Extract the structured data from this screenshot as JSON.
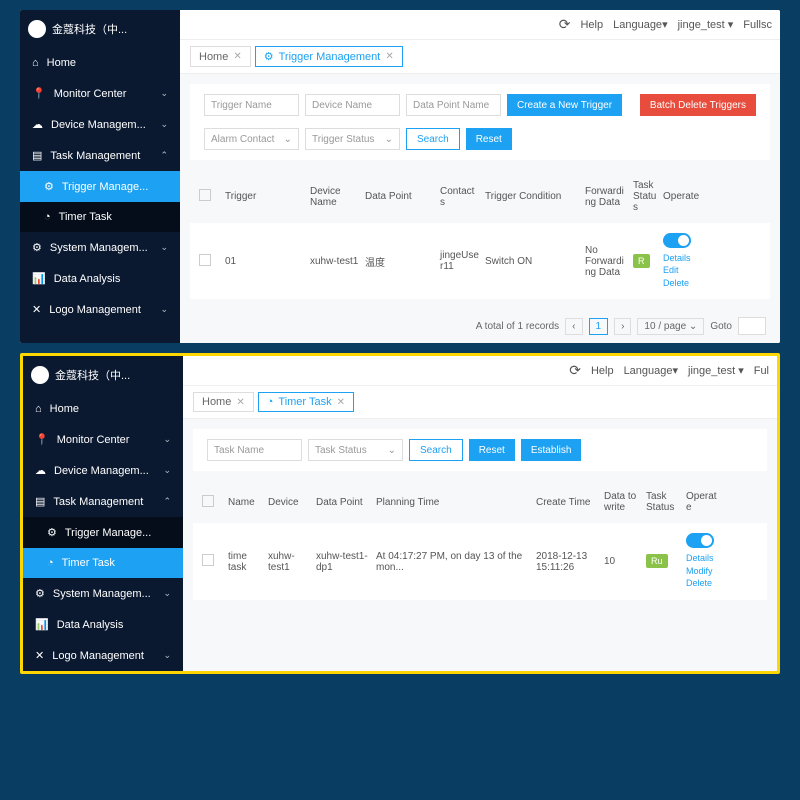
{
  "brand": "金蔻科技（中...",
  "topbar": {
    "help": "Help",
    "language": "Language",
    "user": "jinge_test",
    "full": "Fullsc"
  },
  "nav": {
    "home": "Home",
    "monitor": "Monitor Center",
    "device": "Device Managem...",
    "task": "Task Management",
    "trigger": "Trigger Manage...",
    "timer": "Timer Task",
    "system": "System Managem...",
    "data": "Data Analysis",
    "logo": "Logo Management"
  },
  "s1": {
    "tabs": {
      "home": "Home",
      "trigger": "Trigger Management"
    },
    "filters": {
      "trigger_name": "Trigger Name",
      "device_name": "Device Name",
      "dp_name": "Data Point Name",
      "alarm_contact": "Alarm Contact",
      "trigger_status": "Trigger Status",
      "search": "Search",
      "reset": "Reset",
      "create": "Create a New Trigger",
      "delete": "Batch Delete Triggers"
    },
    "headers": {
      "trigger": "Trigger",
      "device": "Device Name",
      "dp": "Data Point",
      "contacts": "Contacts",
      "cond": "Trigger Condition",
      "fwd": "Forwarding Data",
      "status": "Task Status",
      "op": "Operate"
    },
    "row": {
      "trigger": "01",
      "device": "xuhw-test1",
      "dp": "温度",
      "contacts": "jingeUser11",
      "cond": "Switch ON",
      "fwd": "No Forwarding Data",
      "status": "R"
    },
    "ops": {
      "details": "Details",
      "edit": "Edit",
      "delete": "Delete"
    },
    "pager": {
      "total": "A total of 1 records",
      "page": "1",
      "perpage": "10 / page",
      "goto": "Goto"
    }
  },
  "s2": {
    "topfull": "Ful",
    "tabs": {
      "home": "Home",
      "timer": "Timer Task"
    },
    "filters": {
      "task_name": "Task Name",
      "task_status": "Task Status",
      "search": "Search",
      "reset": "Reset",
      "establish": "Establish"
    },
    "headers": {
      "name": "Name",
      "device": "Device",
      "dp": "Data Point",
      "plan": "Planning Time",
      "create": "Create Time",
      "dtw": "Data to write",
      "status": "Task Status",
      "op": "Operate"
    },
    "row": {
      "name": "time task",
      "device": "xuhw-test1",
      "dp": "xuhw-test1-dp1",
      "plan": "At 04:17:27 PM, on day 13 of the mon...",
      "create": "2018-12-13 15:11:26",
      "dtw": "10",
      "status": "Ru"
    },
    "ops": {
      "details": "Details",
      "modify": "Modify",
      "delete": "Delete"
    }
  }
}
